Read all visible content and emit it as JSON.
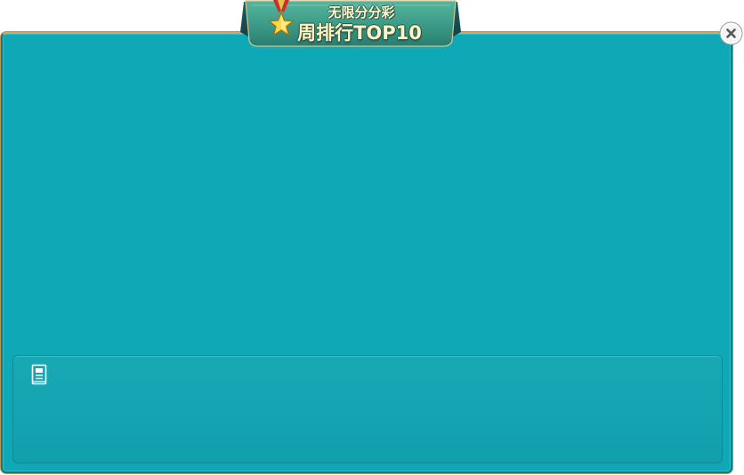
{
  "banner": {
    "title_line1": "无限分分彩",
    "title_line2": "周排行TOP10",
    "medal_icon": "gold-star-medal-icon"
  },
  "close_icon": "close-icon",
  "info_box": {
    "icon": "document-icon"
  },
  "colors": {
    "panel": "#0ea8b6",
    "panel_border": "#cfa765",
    "info_box": "#16a5b2",
    "banner_green": "#3f9a86"
  }
}
